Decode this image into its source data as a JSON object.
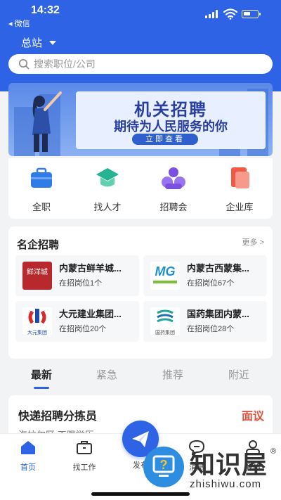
{
  "status_bar": {
    "time": "14:32",
    "back_label": "◂ 微信"
  },
  "header": {
    "location": "总站",
    "search_placeholder": "搜索职位/公司"
  },
  "banner": {
    "title": "机关招聘",
    "subtitle": "期待为人民服务的你",
    "button": "立即查看"
  },
  "quick_nav": [
    {
      "label": "全职",
      "icon": "briefcase-icon",
      "color": "#2f7be8"
    },
    {
      "label": "找人才",
      "icon": "graduation-cap-icon",
      "color": "#27b391"
    },
    {
      "label": "招聘会",
      "icon": "people-group-icon",
      "color": "#7b4fe0"
    },
    {
      "label": "企业库",
      "icon": "company-card-icon",
      "color": "#ef5a45"
    }
  ],
  "famous": {
    "title": "名企招聘",
    "more": "更多 >",
    "companies": [
      {
        "name": "内蒙古鲜羊城...",
        "jobs": "在招岗位1个",
        "logo_text": "鲜洋城"
      },
      {
        "name": "内蒙古西蒙集...",
        "jobs": "在招岗位67个",
        "logo_text": "MG"
      },
      {
        "name": "大元建业集团...",
        "jobs": "在招岗位20个",
        "logo_text": "大元集团"
      },
      {
        "name": "国药集团内蒙...",
        "jobs": "在招岗位28个",
        "logo_text": "国药集团"
      }
    ]
  },
  "tabs": [
    "最新",
    "紧急",
    "推荐",
    "附近"
  ],
  "job": {
    "title": "快递招聘分拣员",
    "salary": "面议",
    "tags": "海拉尔区  不限学历"
  },
  "bottom_nav": [
    {
      "label": "首页",
      "icon": "home-icon"
    },
    {
      "label": "找工作",
      "icon": "briefcase-icon"
    },
    {
      "label": "发布",
      "icon": "paper-plane-icon"
    },
    {
      "label": "消息",
      "icon": "chat-bubble-icon"
    },
    {
      "label": "我的",
      "icon": "user-icon"
    }
  ],
  "watermark": {
    "text": "知识屋",
    "url": "zhishiwu.com",
    "reg": "®"
  },
  "colors": {
    "primary": "#2f63e6",
    "salary": "#e0523c"
  }
}
